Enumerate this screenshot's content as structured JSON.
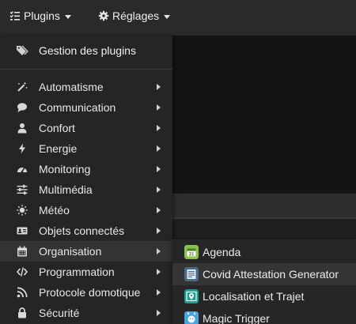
{
  "topbar": {
    "plugins_label": "Plugins",
    "reglages_label": "Réglages"
  },
  "menu": {
    "header": {
      "label": "Gestion des plugins",
      "icon": "tags-icon"
    },
    "items": [
      {
        "label": "Automatisme",
        "icon": "magic-wand-icon"
      },
      {
        "label": "Communication",
        "icon": "comment-icon"
      },
      {
        "label": "Confort",
        "icon": "user-icon"
      },
      {
        "label": "Energie",
        "icon": "bolt-icon"
      },
      {
        "label": "Monitoring",
        "icon": "tachometer-icon"
      },
      {
        "label": "Multimédia",
        "icon": "sliders-icon"
      },
      {
        "label": "Météo",
        "icon": "sun-icon"
      },
      {
        "label": "Objets connectés",
        "icon": "address-card-icon"
      },
      {
        "label": "Organisation",
        "icon": "calendar-icon"
      },
      {
        "label": "Programmation",
        "icon": "code-icon"
      },
      {
        "label": "Protocole domotique",
        "icon": "rss-icon"
      },
      {
        "label": "Sécurité",
        "icon": "lock-icon"
      }
    ]
  },
  "submenu": {
    "items": [
      {
        "label": "Agenda",
        "icon": "agenda-plugin-icon",
        "color": "#8bc34a"
      },
      {
        "label": "Covid Attestation Generator",
        "icon": "attestation-plugin-icon",
        "color": "#4a6a8a"
      },
      {
        "label": "Localisation et Trajet",
        "icon": "localisation-plugin-icon",
        "color": "#1a9e8e"
      },
      {
        "label": "Magic Trigger",
        "icon": "magic-trigger-plugin-icon",
        "color": "#4aa3df"
      }
    ]
  },
  "colors": {
    "menu_bg": "#252525",
    "topbar_bg": "#2a2a2a",
    "active_bg": "#333333"
  }
}
